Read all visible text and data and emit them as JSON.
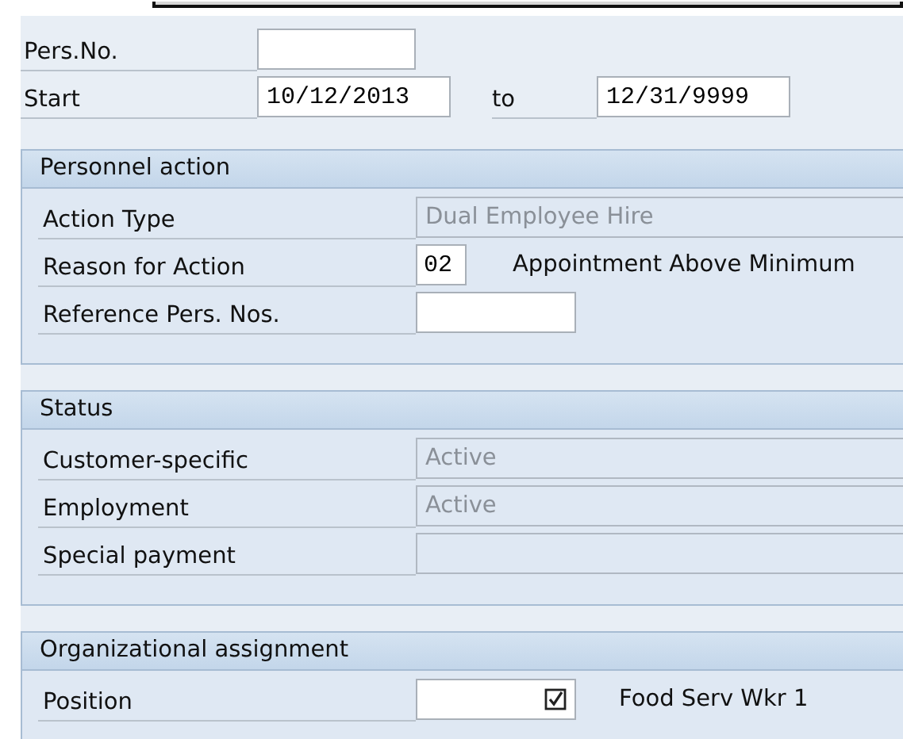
{
  "header": {
    "pers_no": {
      "label": "Pers.No."
    },
    "start": {
      "label": "Start",
      "value": "10/12/2013"
    },
    "to": {
      "label": "to",
      "value": "12/31/9999"
    }
  },
  "sections": [
    {
      "title": "Personnel action",
      "rows": [
        {
          "kind": "display",
          "label": "Action Type",
          "value": "Dual Employee Hire"
        },
        {
          "kind": "code",
          "label": "Reason for Action",
          "value": "02",
          "description": "Appointment Above Minimum"
        },
        {
          "kind": "input",
          "label": "Reference Pers. Nos."
        }
      ]
    },
    {
      "title": "Status",
      "rows": [
        {
          "kind": "display",
          "label": "Customer-specific",
          "value": "Active"
        },
        {
          "kind": "display",
          "label": "Employment",
          "value": "Active"
        },
        {
          "kind": "display",
          "label": "Special payment"
        }
      ]
    },
    {
      "title": "Organizational assignment",
      "rows": [
        {
          "kind": "lookup",
          "label": "Position",
          "description": "Food Serv Wkr 1"
        }
      ]
    }
  ]
}
